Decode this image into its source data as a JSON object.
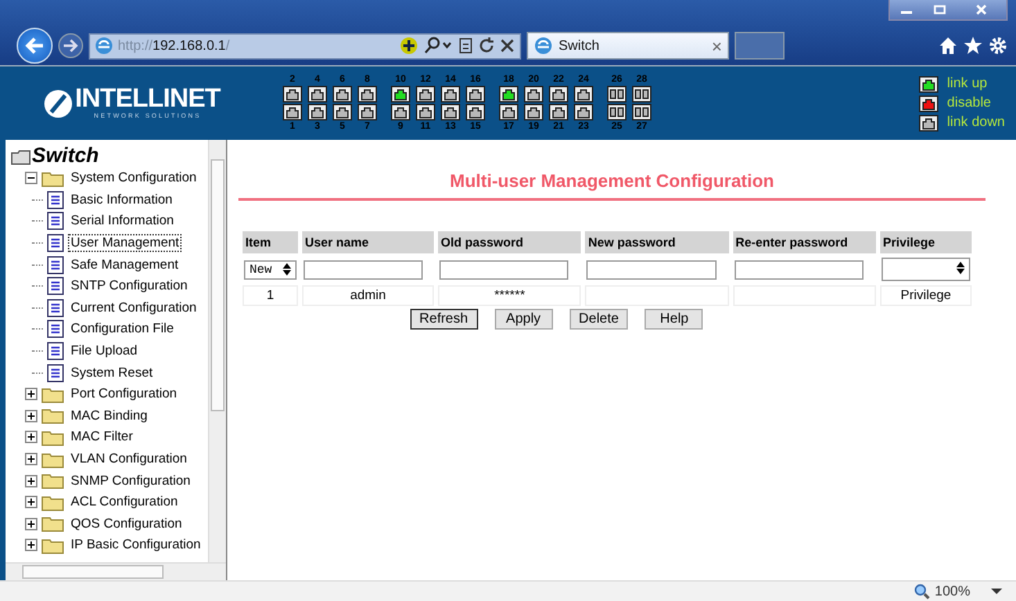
{
  "browser": {
    "address": {
      "scheme": "http://",
      "host": "192.168.0.1",
      "path": "/"
    },
    "tab": {
      "title": "Switch",
      "close": "×"
    }
  },
  "header": {
    "logo": {
      "name": "INTELLINET",
      "tagline": "NETWORK SOLUTIONS"
    },
    "port_groups": [
      [
        {
          "kind": "rj45",
          "top": {
            "label": "2",
            "link_up": false
          },
          "bottom": {
            "label": "1",
            "link_up": false
          }
        },
        {
          "kind": "rj45",
          "top": {
            "label": "4",
            "link_up": false
          },
          "bottom": {
            "label": "3",
            "link_up": false
          }
        },
        {
          "kind": "rj45",
          "top": {
            "label": "6",
            "link_up": false
          },
          "bottom": {
            "label": "5",
            "link_up": false
          }
        },
        {
          "kind": "rj45",
          "top": {
            "label": "8",
            "link_up": false
          },
          "bottom": {
            "label": "7",
            "link_up": false
          }
        }
      ],
      [
        {
          "kind": "rj45",
          "top": {
            "label": "10",
            "link_up": true
          },
          "bottom": {
            "label": "9",
            "link_up": false
          }
        },
        {
          "kind": "rj45",
          "top": {
            "label": "12",
            "link_up": false
          },
          "bottom": {
            "label": "11",
            "link_up": false
          }
        },
        {
          "kind": "rj45",
          "top": {
            "label": "14",
            "link_up": false
          },
          "bottom": {
            "label": "13",
            "link_up": false
          }
        },
        {
          "kind": "rj45",
          "top": {
            "label": "16",
            "link_up": false
          },
          "bottom": {
            "label": "15",
            "link_up": false
          }
        }
      ],
      [
        {
          "kind": "rj45",
          "top": {
            "label": "18",
            "link_up": true
          },
          "bottom": {
            "label": "17",
            "link_up": false
          }
        },
        {
          "kind": "rj45",
          "top": {
            "label": "20",
            "link_up": false
          },
          "bottom": {
            "label": "19",
            "link_up": false
          }
        },
        {
          "kind": "rj45",
          "top": {
            "label": "22",
            "link_up": false
          },
          "bottom": {
            "label": "21",
            "link_up": false
          }
        },
        {
          "kind": "rj45",
          "top": {
            "label": "24",
            "link_up": false
          },
          "bottom": {
            "label": "23",
            "link_up": false
          }
        }
      ],
      [
        {
          "kind": "sfp",
          "top": {
            "label": "26",
            "link_up": false
          },
          "bottom": {
            "label": "25",
            "link_up": false
          }
        },
        {
          "kind": "sfp",
          "top": {
            "label": "28",
            "link_up": false
          },
          "bottom": {
            "label": "27",
            "link_up": false
          }
        }
      ]
    ],
    "legend": [
      {
        "label": "link up",
        "color": "#22dd22"
      },
      {
        "label": "disable",
        "color": "#ee1111"
      },
      {
        "label": "link down",
        "color": "#b8b8b8"
      }
    ]
  },
  "sidebar": {
    "root": "Switch",
    "items": [
      {
        "label": "System Configuration",
        "expanded": true,
        "children": [
          {
            "label": "Basic Information",
            "selected": false
          },
          {
            "label": "Serial Information",
            "selected": false
          },
          {
            "label": "User Management",
            "selected": true
          },
          {
            "label": "Safe Management",
            "selected": false
          },
          {
            "label": "SNTP Configuration",
            "selected": false
          },
          {
            "label": "Current Configuration",
            "selected": false
          },
          {
            "label": "Configuration File",
            "selected": false
          },
          {
            "label": "File Upload",
            "selected": false
          },
          {
            "label": "System Reset",
            "selected": false
          }
        ]
      },
      {
        "label": "Port Configuration",
        "expanded": false
      },
      {
        "label": "MAC Binding",
        "expanded": false
      },
      {
        "label": "MAC Filter",
        "expanded": false
      },
      {
        "label": "VLAN Configuration",
        "expanded": false
      },
      {
        "label": "SNMP Configuration",
        "expanded": false
      },
      {
        "label": "ACL Configuration",
        "expanded": false
      },
      {
        "label": "QOS Configuration",
        "expanded": false
      },
      {
        "label": "IP Basic Configuration",
        "expanded": false
      }
    ]
  },
  "content": {
    "title": "Multi-user Management Configuration",
    "table": {
      "columns": [
        "Item",
        "User name",
        "Old password",
        "New password",
        "Re-enter password",
        "Privilege"
      ],
      "new_row": {
        "item": "New"
      },
      "rows": [
        [
          "1",
          "admin",
          "******",
          "",
          "",
          "Privilege"
        ]
      ]
    },
    "buttons": [
      "Refresh",
      "Apply",
      "Delete",
      "Help"
    ]
  },
  "status_bar": {
    "zoom": "100%"
  }
}
